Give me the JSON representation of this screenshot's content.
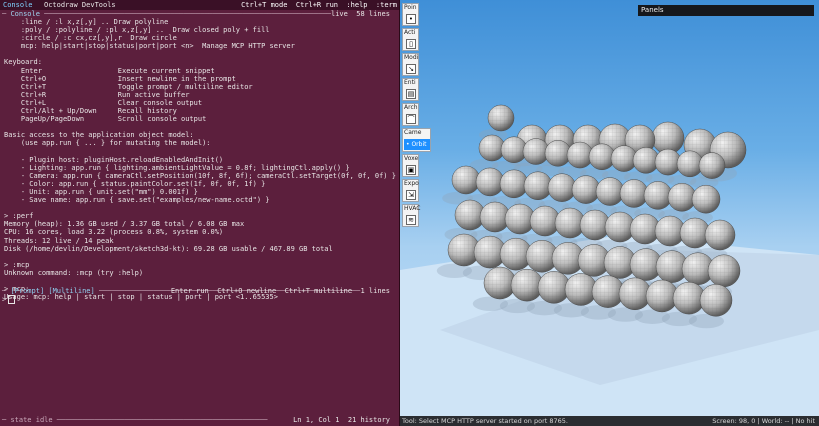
{
  "console_header": {
    "tabs": [
      "Console",
      "Octodraw DevTools"
    ],
    "active_tab": "Console",
    "right": "Ctrl+T mode  Ctrl+R run  :help  :term"
  },
  "console_frame": {
    "title": "Console",
    "right": "live  58 lines"
  },
  "console_lines": [
    "    :line / :l x,z[,y] .. Draw polyline",
    "    :poly / :polyline / :pl x,z[,y] ..  Draw closed poly + fill",
    "    :circle / :c cx,cz[,y],r  Draw circle",
    "    mcp: help|start|stop|status|port|port <n>  Manage MCP HTTP server",
    "",
    "Keyboard:",
    "    Enter                  Execute current snippet",
    "    Ctrl+O                 Insert newline in the prompt",
    "    Ctrl+T                 Toggle prompt / multiline editor",
    "    Ctrl+R                 Run active buffer",
    "    Ctrl+L                 Clear console output",
    "    Ctrl/Alt + Up/Down     Recall history",
    "    PageUp/PageDown        Scroll console output",
    "",
    "Basic access to the application object model:",
    "    (use app.run { ... } for mutating the model):",
    "",
    "    - Plugin host: pluginHost.reloadEnabledAndInit()",
    "    - Lighting: app.run { lighting.ambientLightValue = 0.8f; lightingCtl.apply() }",
    "    - Camera: app.run { cameraCtl.setPosition(10f, 8f, 6f); cameraCtl.setTarget(0f, 0f, 0f) }",
    "    - Color: app.run { status.paintColor.set(1f, 0f, 0f, 1f) }",
    "    - Unit: app.run { unit.set(\"mm\") 0.001f) }",
    "    - Save name: app.run { save.set(\"examples/new-name.octd\") }",
    "",
    "> :perf",
    "Memory (heap): 1.36 GB used / 3.37 GB total / 6.08 GB max",
    "CPU: 16 cores, load 3.22 (process 0.8%, system 0.0%)",
    "Threads: 12 live / 14 peak",
    "Disk (/home/devlin/Development/sketch3d-kt): 69.28 GB usable / 467.89 GB total",
    "",
    "> :mcp",
    "Unknown command: :mcp (try :help)",
    "",
    "> mcp:",
    "Usage: mcp: help | start | stop | status | port | port <1..65535>"
  ],
  "prompt_bar": {
    "label": "[Prompt] [Multiline]",
    "right": "Enter run  Ctrl+O newline  Ctrl+T multiline  1 lines"
  },
  "input": {
    "prefix": ">",
    "value": ""
  },
  "console_status": {
    "left": "state idle",
    "right": "Ln 1, Col 1  21 history"
  },
  "viewport": {
    "panels_label": "Panels",
    "tools": [
      {
        "label": "Poin",
        "icon": "point-icon",
        "glyph": "•"
      },
      {
        "label": "Acti",
        "icon": "actions-icon",
        "glyph": "▯"
      },
      {
        "label": "Modi",
        "icon": "modify-icon",
        "glyph": "↘"
      },
      {
        "label": "Enti",
        "icon": "entities-icon",
        "glyph": "▤"
      },
      {
        "label": "Arch",
        "icon": "arch-icon",
        "glyph": "⌒"
      }
    ],
    "camera_tool": {
      "label": "Came",
      "mode": "• Orbit"
    },
    "tools_after": [
      {
        "label": "Voxe",
        "icon": "voxel-icon",
        "glyph": "▣"
      },
      {
        "label": "Expo",
        "icon": "export-icon",
        "glyph": "⇲"
      },
      {
        "label": "HVAC",
        "icon": "hvac-icon",
        "glyph": "≋"
      }
    ],
    "status_left": "Tool: Select MCP HTTP server started on port 8765.",
    "status_right": "Screen: 98, 0 | World: -- | No hit"
  },
  "colors": {
    "console_bg": "#5c1f3d",
    "console_header_bg": "#3a1026",
    "accent": "#7fd3ff",
    "sphere": "#bdbdbd",
    "sky_top": "#3f8fd7",
    "ground": "#c8e1f6",
    "orbit_button": "#1e90ff"
  }
}
